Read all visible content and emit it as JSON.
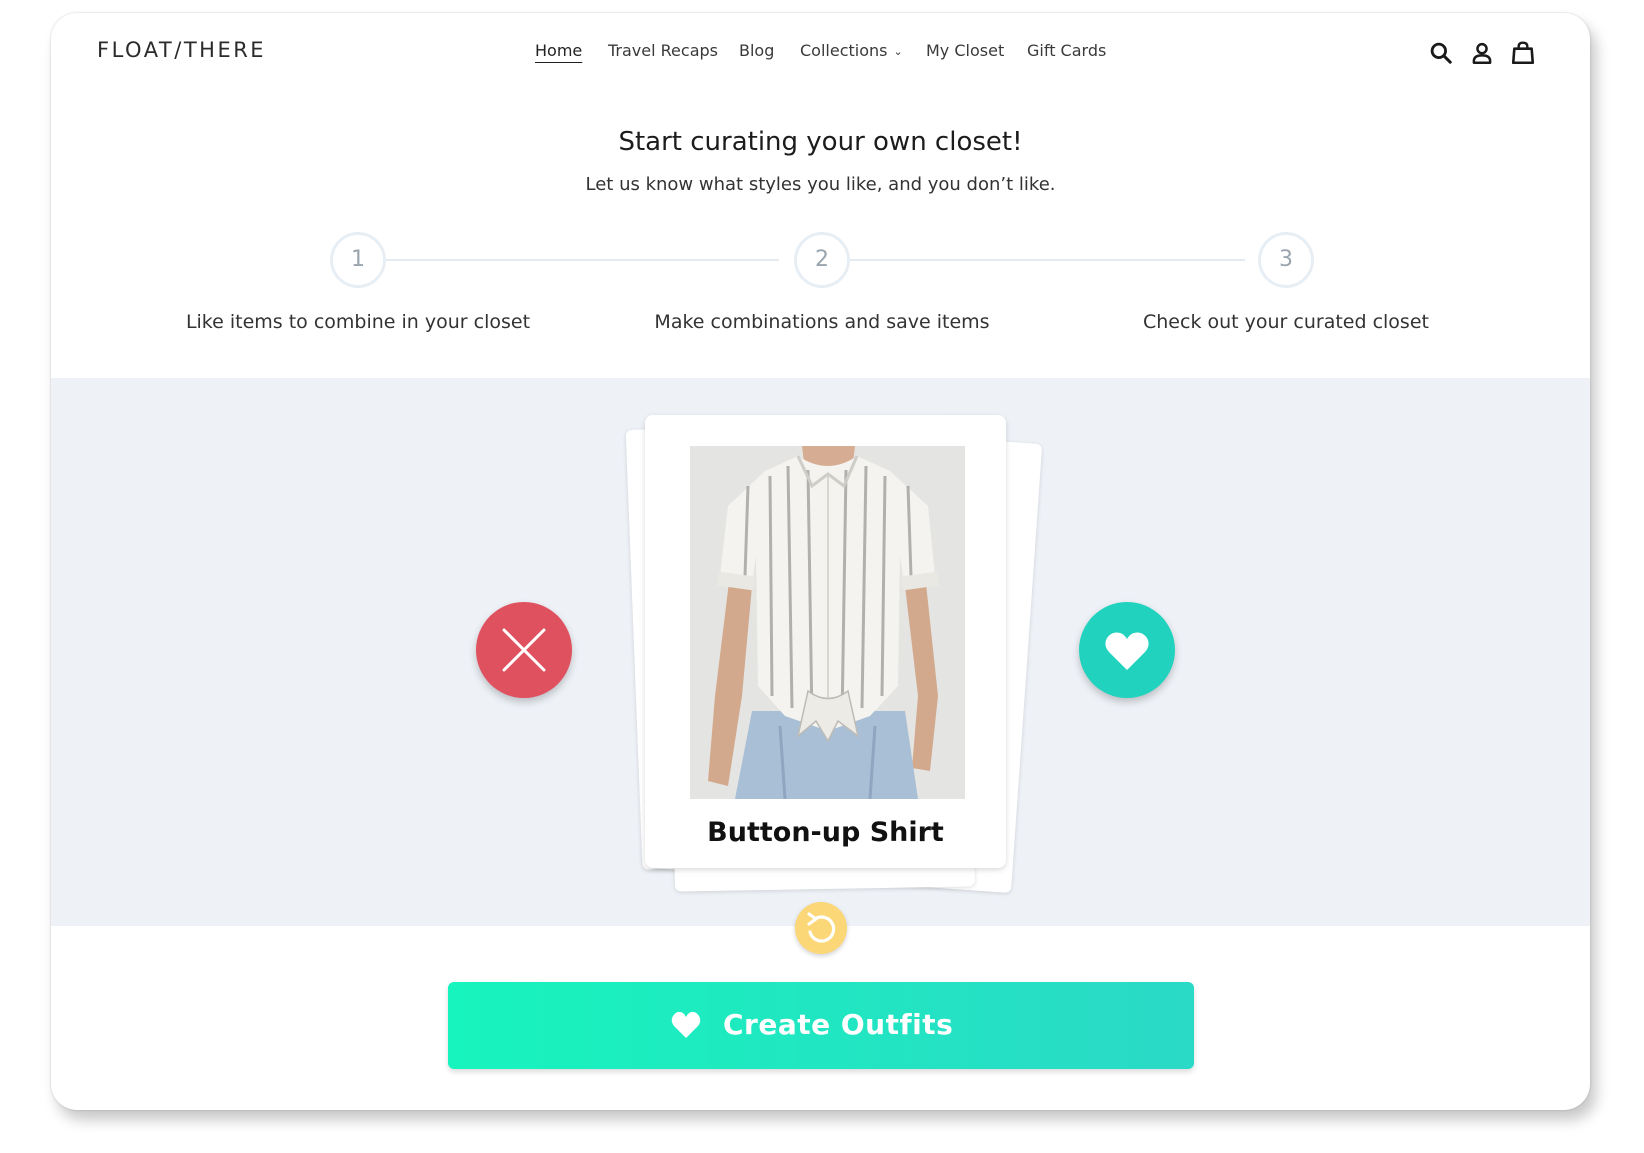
{
  "header": {
    "logo": "FLOAT/THERE",
    "nav": [
      {
        "label": "Home",
        "active": true
      },
      {
        "label": "Travel Recaps",
        "active": false
      },
      {
        "label": "Blog",
        "active": false
      },
      {
        "label": "Collections",
        "active": false,
        "has_dropdown": true
      },
      {
        "label": "My Closet",
        "active": false
      },
      {
        "label": "Gift Cards",
        "active": false
      }
    ],
    "icons": [
      "search-icon",
      "account-icon",
      "cart-icon"
    ]
  },
  "hero": {
    "title": "Start curating your own closet!",
    "subtitle": "Let us know what styles you like, and you don’t like."
  },
  "steps": [
    {
      "number": "1",
      "label": "Like items to combine in your closet"
    },
    {
      "number": "2",
      "label": "Make combinations and save items"
    },
    {
      "number": "3",
      "label": "Check out your curated closet"
    }
  ],
  "card": {
    "title": "Button-up Shirt",
    "image": "striped-shirt-photo"
  },
  "actions": {
    "dislike_icon": "close-icon",
    "like_icon": "heart-icon",
    "undo_icon": "undo-icon",
    "create_label": "Create Outfits"
  },
  "colors": {
    "dislike": "#e0515f",
    "like": "#21d2be",
    "undo": "#fbd777",
    "create_start": "#17f4bd",
    "create_end": "#2ad9c6",
    "swipe_bg": "#eef2f7"
  }
}
